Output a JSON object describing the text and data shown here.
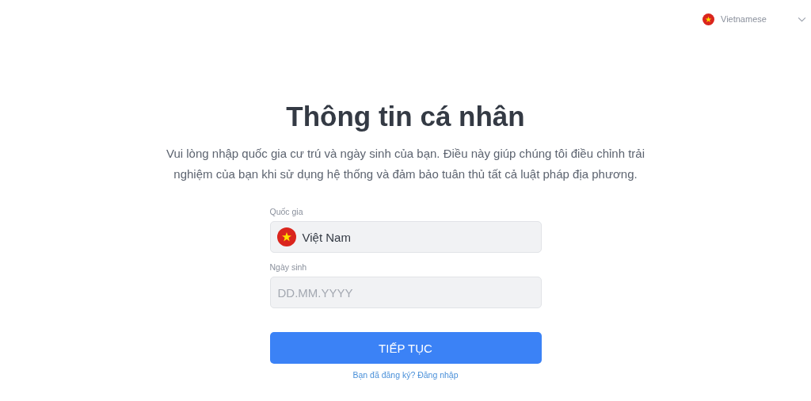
{
  "language_selector": {
    "value": "Vietnamese"
  },
  "title": "Thông tin cá nhân",
  "description": "Vui lòng nhập quốc gia cư trú và ngày sinh của bạn. Điều này giúp chúng tôi điều chỉnh trải nghiệm của bạn khi sử dụng hệ thống và đảm bảo tuân thủ tất cả luật pháp địa phương.",
  "fields": [
    {
      "kind": "select",
      "label": "Quốc gia",
      "value": "Việt Nam"
    },
    {
      "kind": "input",
      "label": "Ngày sinh",
      "placeholder": "DD.MM.YYYY"
    }
  ],
  "submit_button": "TIẾP TỤC",
  "login_link": "Bạn đã đăng ký? Đăng nhập"
}
